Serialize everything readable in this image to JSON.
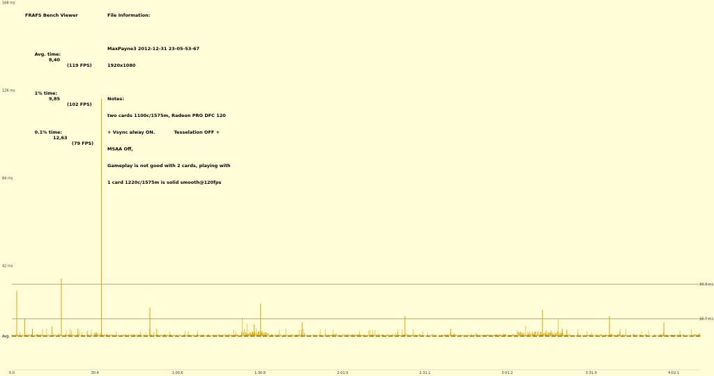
{
  "app": {
    "title": "FRAFS Bench Viewer"
  },
  "stats": {
    "avg_label": "Avg. time:",
    "avg_value": "8,40",
    "avg_fps": "(119 FPS)",
    "p1_label": "1% time:",
    "p1_value": "9,85",
    "p1_fps": "(102 FPS)",
    "p01_label": "0.1% time:",
    "p01_value": "12,63",
    "p01_fps": "(79 FPS)"
  },
  "file_info": {
    "heading": "File Information:",
    "filename": "MaxPayne3 2012-12-31 23-05-53-67",
    "resolution": "1920x1080",
    "notes_heading": "Notes:",
    "notes_lines": [
      "two cards 1100c/1575m, Radeon PRO DFC 120",
      "+ Vsync alway ON.            Tesselation OFF +",
      "MSAA Off,",
      "Gameplay is not good with 2 cards, playing with",
      "1 card 1220c/1575m is solid smooth@120fps"
    ]
  },
  "chart_data": {
    "type": "line",
    "xlabel": "",
    "ylabel": "",
    "ylim": [
      0,
      168
    ],
    "y_ticks": [
      "168 ms",
      "126 ms",
      "84 ms",
      "42 ms",
      "Avg."
    ],
    "y_tick_values": [
      168,
      126,
      84,
      42,
      8.4
    ],
    "x_ticks": [
      "0.0",
      "30.4",
      "1:00.6",
      "1:30.8",
      "2:01.0",
      "2:31.1",
      "3:01.2",
      "3:31.9",
      "4:02.1"
    ],
    "x_tick_seconds": [
      0,
      30.4,
      60.6,
      90.8,
      121.0,
      151.1,
      181.2,
      211.9,
      242.1
    ],
    "xlim": [
      0,
      252
    ],
    "reference_lines": [
      {
        "label": "33.3 ms",
        "value": 33.3
      },
      {
        "label": "16.7 ms",
        "value": 16.7
      }
    ],
    "avg_value": 8.4,
    "avg_label": "Avg.",
    "spikes": [
      {
        "t": 1.8,
        "ms": 30
      },
      {
        "t": 4.7,
        "ms": 17
      },
      {
        "t": 7.5,
        "ms": 12
      },
      {
        "t": 14.7,
        "ms": 13
      },
      {
        "t": 18.1,
        "ms": 36
      },
      {
        "t": 24.2,
        "ms": 12
      },
      {
        "t": 27.6,
        "ms": 11
      },
      {
        "t": 32.8,
        "ms": 122
      },
      {
        "t": 50.5,
        "ms": 22
      },
      {
        "t": 53.0,
        "ms": 12
      },
      {
        "t": 88.6,
        "ms": 14
      },
      {
        "t": 91.0,
        "ms": 24
      },
      {
        "t": 106.2,
        "ms": 15
      },
      {
        "t": 143.8,
        "ms": 18
      },
      {
        "t": 160.5,
        "ms": 12
      },
      {
        "t": 194.1,
        "ms": 21
      },
      {
        "t": 201.3,
        "ms": 12
      },
      {
        "t": 218.6,
        "ms": 18
      },
      {
        "t": 238.5,
        "ms": 15
      }
    ],
    "dense_regions": [
      {
        "from": 0,
        "to": 252,
        "amplitude": 2
      },
      {
        "from": 30,
        "to": 33,
        "amplitude": 4
      },
      {
        "from": 84,
        "to": 94,
        "amplitude": 5
      },
      {
        "from": 185,
        "to": 202,
        "amplitude": 5
      }
    ]
  },
  "colors": {
    "background": "#fffdd8",
    "series": "#d9a300",
    "avg_line": "#6b4f00",
    "ref_line": "#9a8a5a",
    "axis": "#c9c09a"
  }
}
